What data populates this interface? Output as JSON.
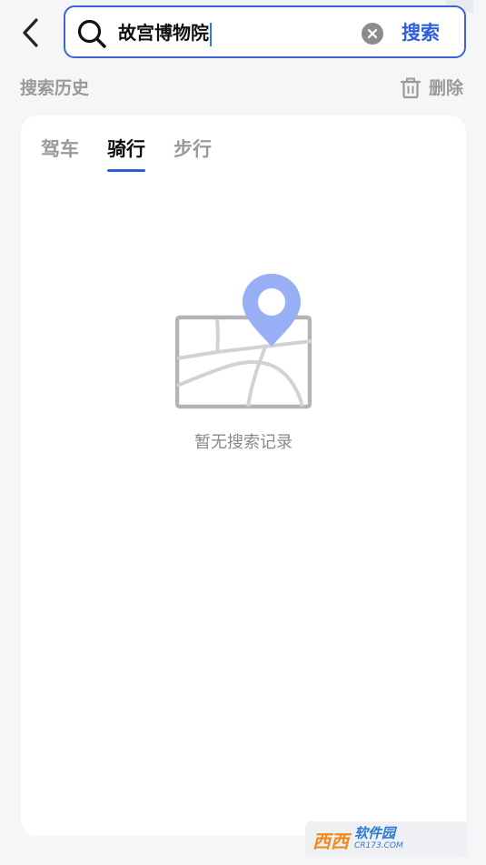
{
  "header": {
    "search_query": "故宫博物院",
    "search_button_label": "搜索",
    "brand_color": "#2f5fd8"
  },
  "history": {
    "title": "搜索历史",
    "delete_label": "删除"
  },
  "tabs": [
    {
      "label": "驾车",
      "active": false
    },
    {
      "label": "骑行",
      "active": true
    },
    {
      "label": "步行",
      "active": false
    }
  ],
  "empty_state": {
    "message": "暂无搜索记录",
    "icon": "map-pin-icon"
  },
  "watermark": {
    "corner_text": "",
    "brand_text": "西西",
    "site_name": "软件园",
    "site_url": "CR173.COM"
  }
}
